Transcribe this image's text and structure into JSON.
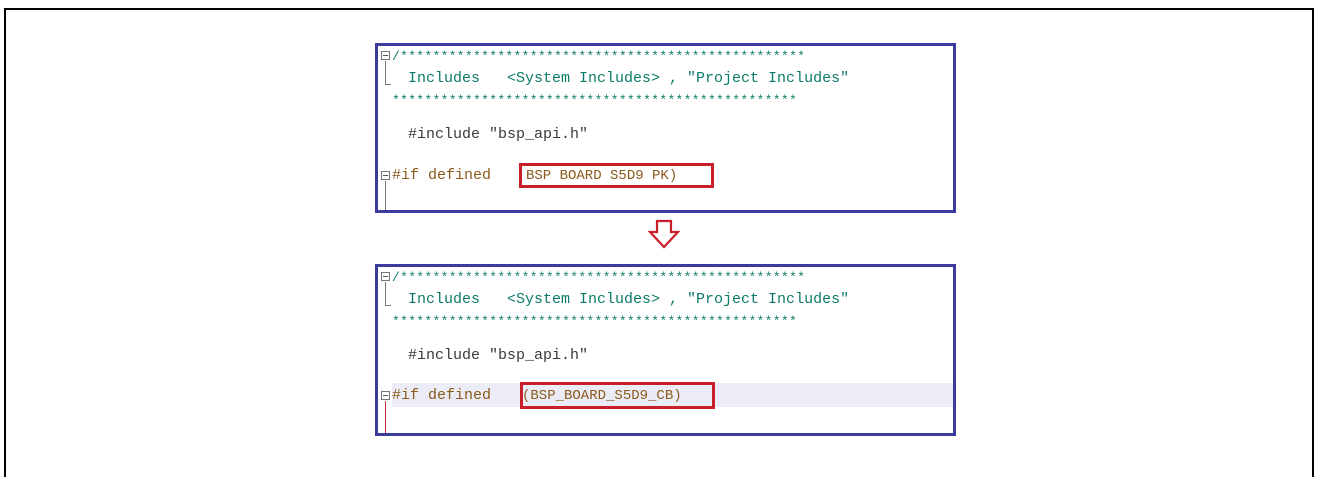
{
  "header_fragment": "_  _  _",
  "snippets": [
    {
      "comment_top": "/**************************************************",
      "comment_text": "Includes   <System Includes> , \"Project Includes\"",
      "comment_bottom": "**************************************************",
      "include_line": "#include \"bsp_api.h\"",
      "if_prefix": "#if defined",
      "macro": "BSP BOARD S5D9 PK)",
      "highlighted": false
    },
    {
      "comment_top": "/**************************************************",
      "comment_text": "Includes   <System Includes> , \"Project Includes\"",
      "comment_bottom": "**************************************************",
      "include_line": "#include \"bsp_api.h\"",
      "if_prefix": "#if defined",
      "macro": "(BSP_BOARD_S5D9_CB)",
      "highlighted": true
    }
  ],
  "colors": {
    "snippet_border": "#3b3b9b",
    "highlight_box": "#c8202a",
    "arrow": "#c8202a",
    "comment": "#0c7a6a",
    "preprocessor": "#8a5a1a"
  },
  "icons": {
    "down_arrow": "down-arrow-icon",
    "fold": "fold-minus-icon"
  }
}
